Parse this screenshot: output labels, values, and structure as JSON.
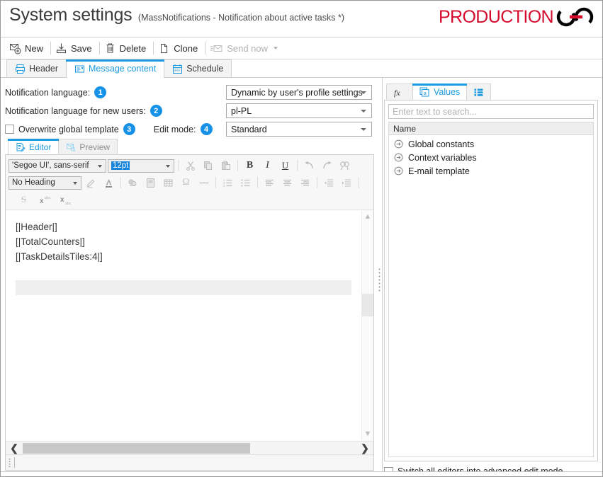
{
  "window": {
    "title": "System settings",
    "subtitle": "(MassNotifications - Notification about active tasks *)",
    "logo_text": "PRODUCTION"
  },
  "commandbar": {
    "items": [
      {
        "label": "New",
        "icon": "new-mail-icon",
        "disabled": false
      },
      {
        "label": "Save",
        "icon": "save-icon",
        "disabled": false
      },
      {
        "label": "Delete",
        "icon": "trash-icon",
        "disabled": false
      },
      {
        "label": "Clone",
        "icon": "page-copy-icon",
        "disabled": false
      },
      {
        "label": "Send now",
        "icon": "send-mail-icon",
        "disabled": true
      }
    ]
  },
  "main_tabs": [
    {
      "label": "Header",
      "icon": "printer-icon",
      "active": false
    },
    {
      "label": "Message content",
      "icon": "message-icon",
      "active": true
    },
    {
      "label": "Schedule",
      "icon": "calendar-icon",
      "active": false
    }
  ],
  "form": {
    "rows": [
      {
        "label": "Notification language:",
        "badge": "1",
        "value": "Dynamic by user's profile settings"
      },
      {
        "label": "Notification language for new users:",
        "badge": "2",
        "value": "pl-PL"
      }
    ],
    "overwrite": {
      "label": "Overwrite global template",
      "badge": "3",
      "checked": false
    },
    "edit_mode": {
      "label": "Edit mode:",
      "badge": "4",
      "value": "Standard"
    }
  },
  "editor_tabs": [
    {
      "label": "Editor",
      "icon": "editor-pencil-icon",
      "active": true
    },
    {
      "label": "Preview",
      "icon": "preview-envelope-icon",
      "active": false
    }
  ],
  "rich_toolbar": {
    "font_family": "'Segoe UI', sans-serif",
    "font_size": "12pt",
    "heading": "No Heading",
    "row1_icons": [
      "cut-icon",
      "copy-icon",
      "paste-icon",
      "bold-icon",
      "italic-icon",
      "underline-icon",
      "undo-icon",
      "redo-icon",
      "find-icon"
    ],
    "row2_icons": [
      "highlight-icon",
      "font-color-icon",
      "link-icon",
      "image-icon",
      "table-icon",
      "special-char-icon",
      "horizontal-rule-icon",
      "ordered-list-icon",
      "bullet-list-icon",
      "align-left-icon",
      "align-center-icon",
      "align-right-icon",
      "outdent-icon",
      "indent-icon"
    ],
    "row3_icons": [
      "strikethrough-icon",
      "superscript-icon",
      "subscript-icon"
    ]
  },
  "editor_content": {
    "lines": [
      "[|Header|]",
      "[|TotalCounters|]",
      "[|TaskDetailsTiles:4|]"
    ]
  },
  "right_panel": {
    "tabs": [
      {
        "label": "",
        "icon": "function-fx-icon",
        "active": false
      },
      {
        "label": "Values",
        "icon": "values-a-icon",
        "active": true
      },
      {
        "label": "",
        "icon": "list-detail-icon",
        "active": false
      }
    ],
    "search_placeholder": "Enter text to search...",
    "column_header": "Name",
    "tree_items": [
      {
        "label": "Global constants",
        "icon": "expand-arrow-icon"
      },
      {
        "label": "Context variables",
        "icon": "expand-arrow-icon"
      },
      {
        "label": "E-mail template",
        "icon": "expand-arrow-icon"
      }
    ],
    "advanced_mode": {
      "label": "Switch all editors into advanced edit mode",
      "checked": false
    }
  },
  "colors": {
    "accent": "#1a9ae0",
    "badge": "#1591e8",
    "logo_red": "#d50b2e",
    "selection_blue": "#1683d8"
  }
}
